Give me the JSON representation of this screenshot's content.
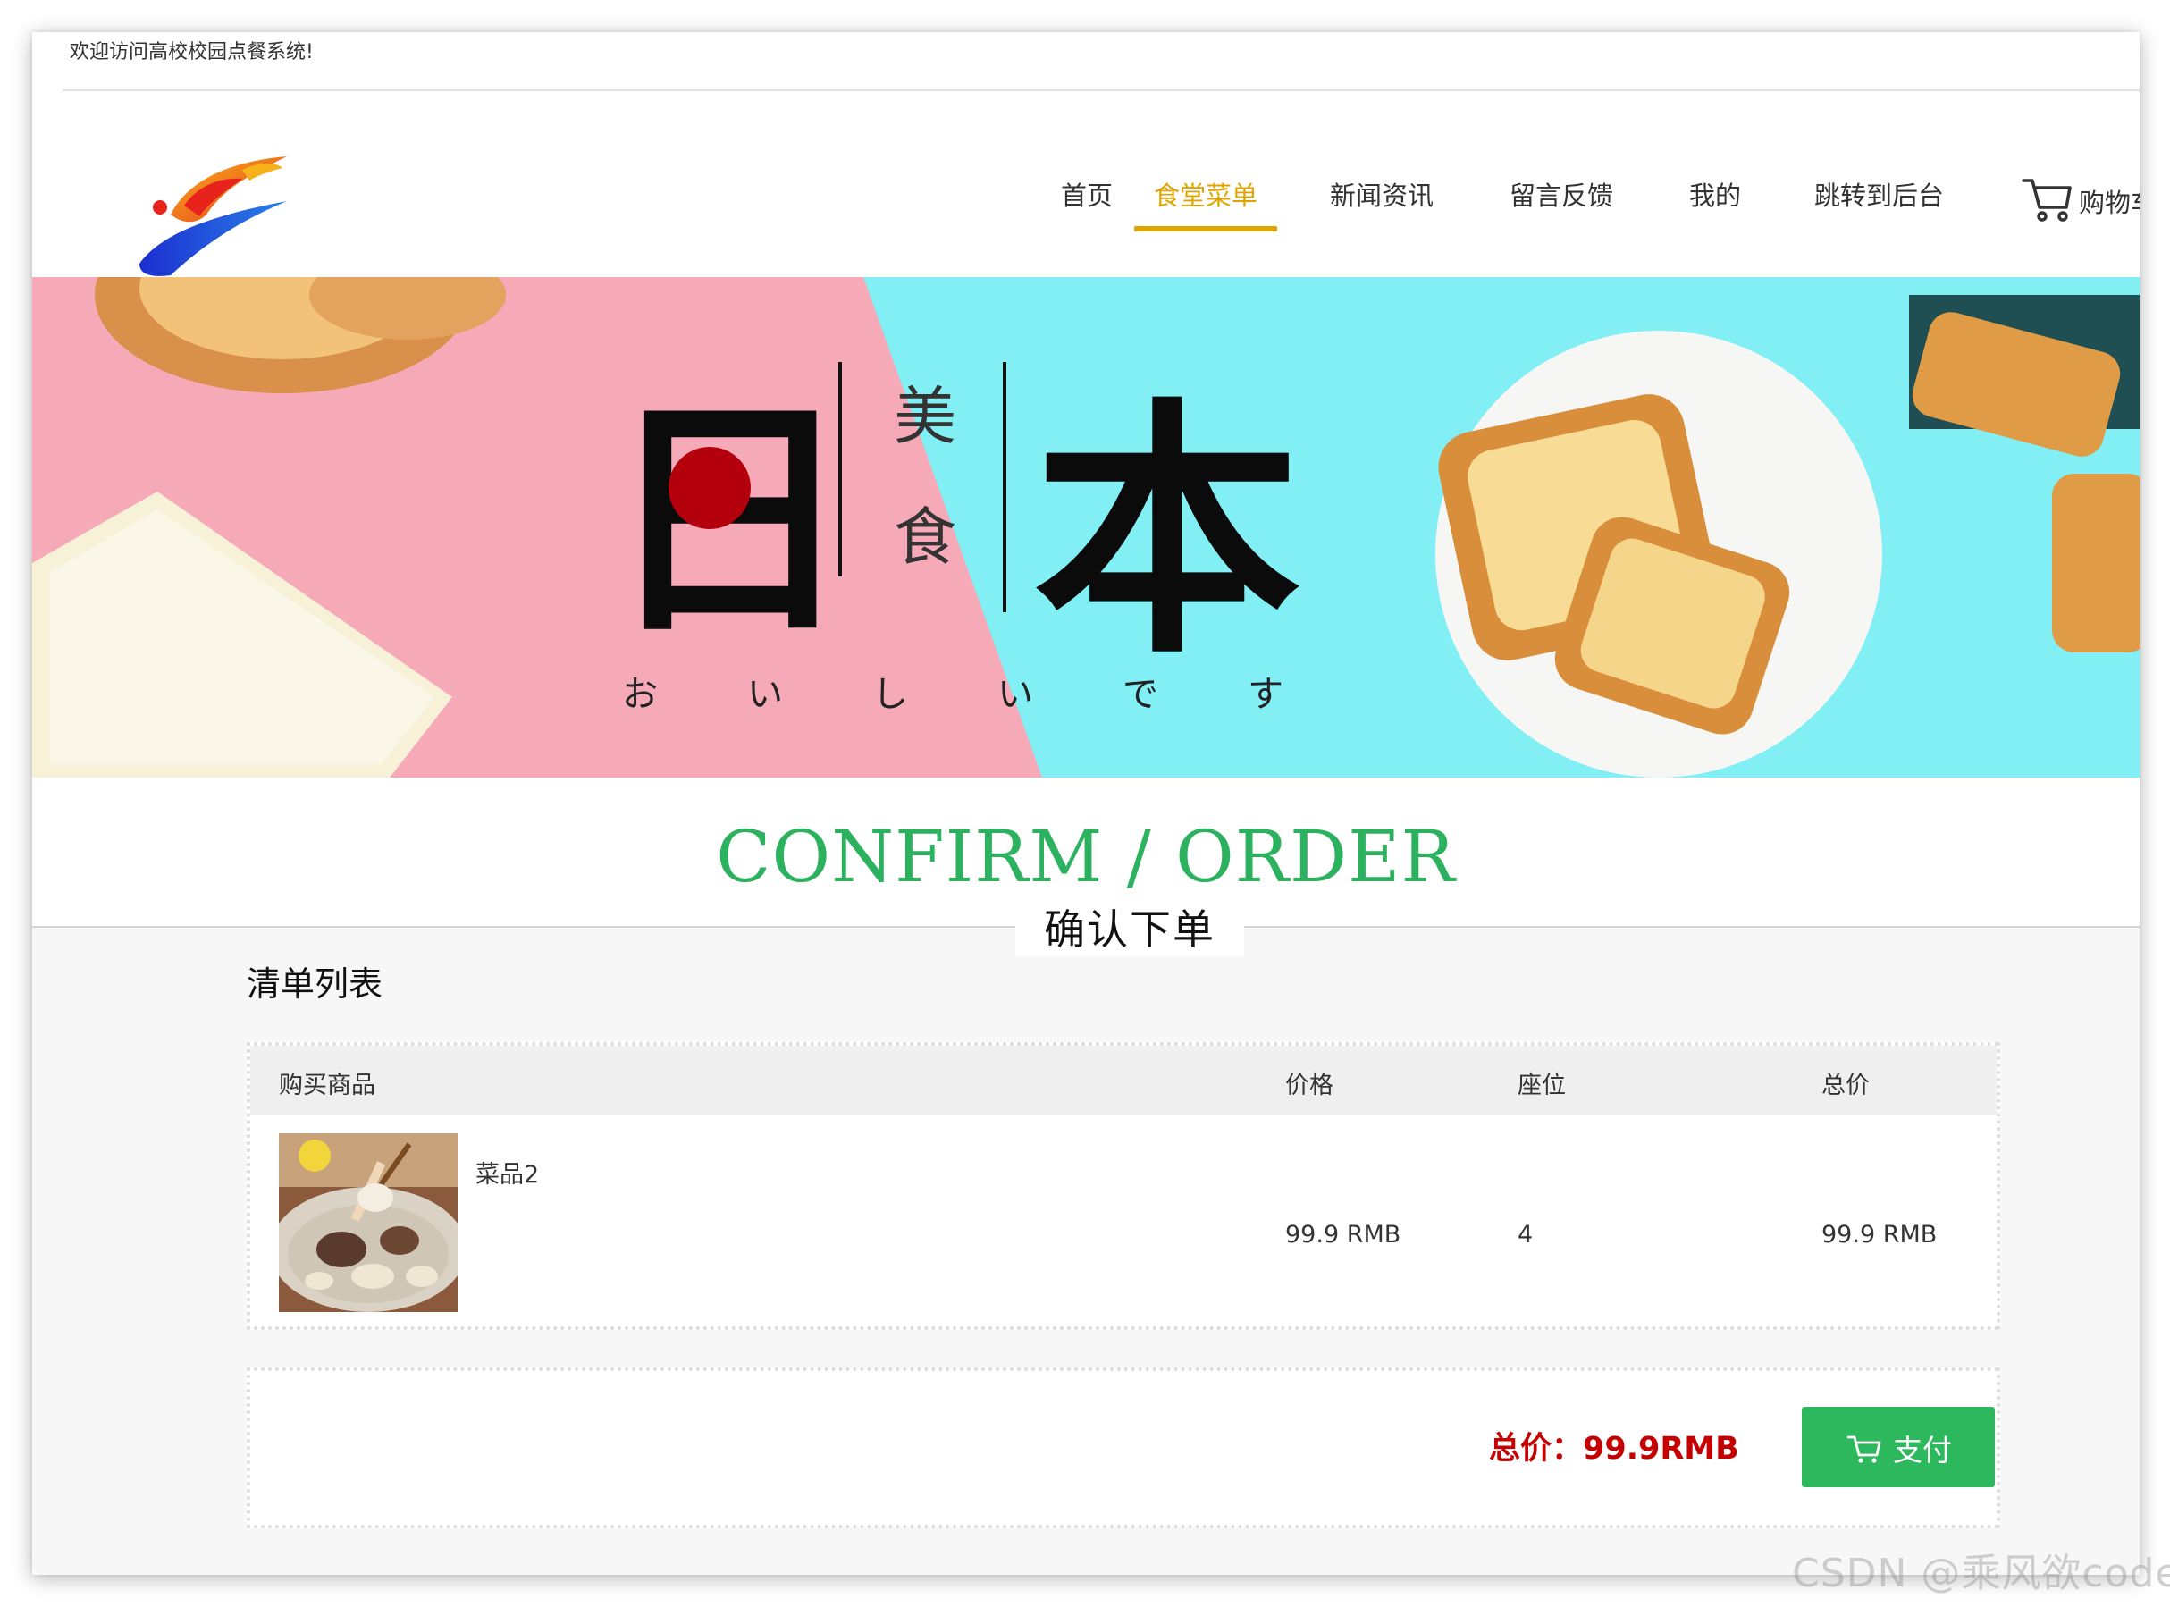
{
  "top": {
    "welcome": "欢迎访问高校校园点餐系统!"
  },
  "nav": {
    "items": [
      "首页",
      "食堂菜单",
      "新闻资讯",
      "留言反馈",
      "我的",
      "跳转到后台"
    ],
    "active": "食堂菜单",
    "cart_label": "购物车"
  },
  "banner": {
    "big_left": "日",
    "big_right": "本",
    "small_top": "美",
    "small_bottom": "食",
    "kana": [
      "お",
      "い",
      "し",
      "い",
      "で",
      "す"
    ]
  },
  "page": {
    "title": "CONFIRM / ORDER",
    "subtitle": "确认下单"
  },
  "list": {
    "title": "清单列表",
    "headers": {
      "product": "购买商品",
      "price": "价格",
      "seat": "座位",
      "total": "总价"
    },
    "rows": [
      {
        "name": "菜品2",
        "price": "99.9 RMB",
        "seat": "4",
        "total": "99.9 RMB"
      }
    ]
  },
  "summary": {
    "total_label": "总价：99.9RMB",
    "pay_label": "支付"
  },
  "watermark": "CSDN @乘风欲code",
  "colors": {
    "accent_green": "#2cb25f",
    "nav_active": "#e0a400",
    "total_red": "#c40000",
    "banner_pink": "#f6a9b6",
    "banner_cyan": "#82eff5"
  }
}
